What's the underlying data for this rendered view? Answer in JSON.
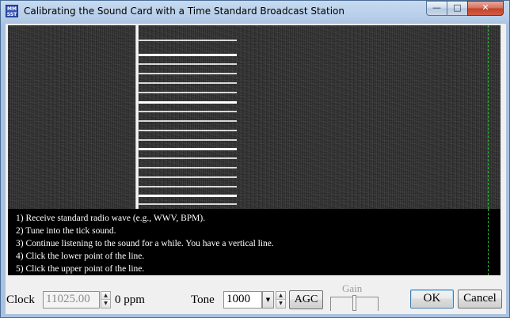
{
  "window": {
    "title": "Calibrating the Sound Card with a Time Standard Broadcast Station",
    "app_icon_text": "MMSSTV",
    "minimize_glyph": "—",
    "maximize_glyph": "□",
    "close_glyph": "✕"
  },
  "instructions": [
    "1) Receive standard radio wave (e.g., WWV, BPM).",
    "2) Tune into the tick sound.",
    "3) Continue listening to the sound for a while.  You have a vertical line.",
    "4) Click the lower point of the line.",
    "5) Click the upper point of the line."
  ],
  "controls": {
    "clock_label": "Clock",
    "clock_value": "11025.00",
    "ppm_text": "0 ppm",
    "tone_label": "Tone",
    "tone_value": "1000",
    "agc_label": "AGC",
    "gain_label": "Gain",
    "ok_label": "OK",
    "cancel_label": "Cancel"
  },
  "colors": {
    "marker": "#2fbf3a",
    "display_bg": "#2c2c2c",
    "instructions_bg": "#000000"
  }
}
